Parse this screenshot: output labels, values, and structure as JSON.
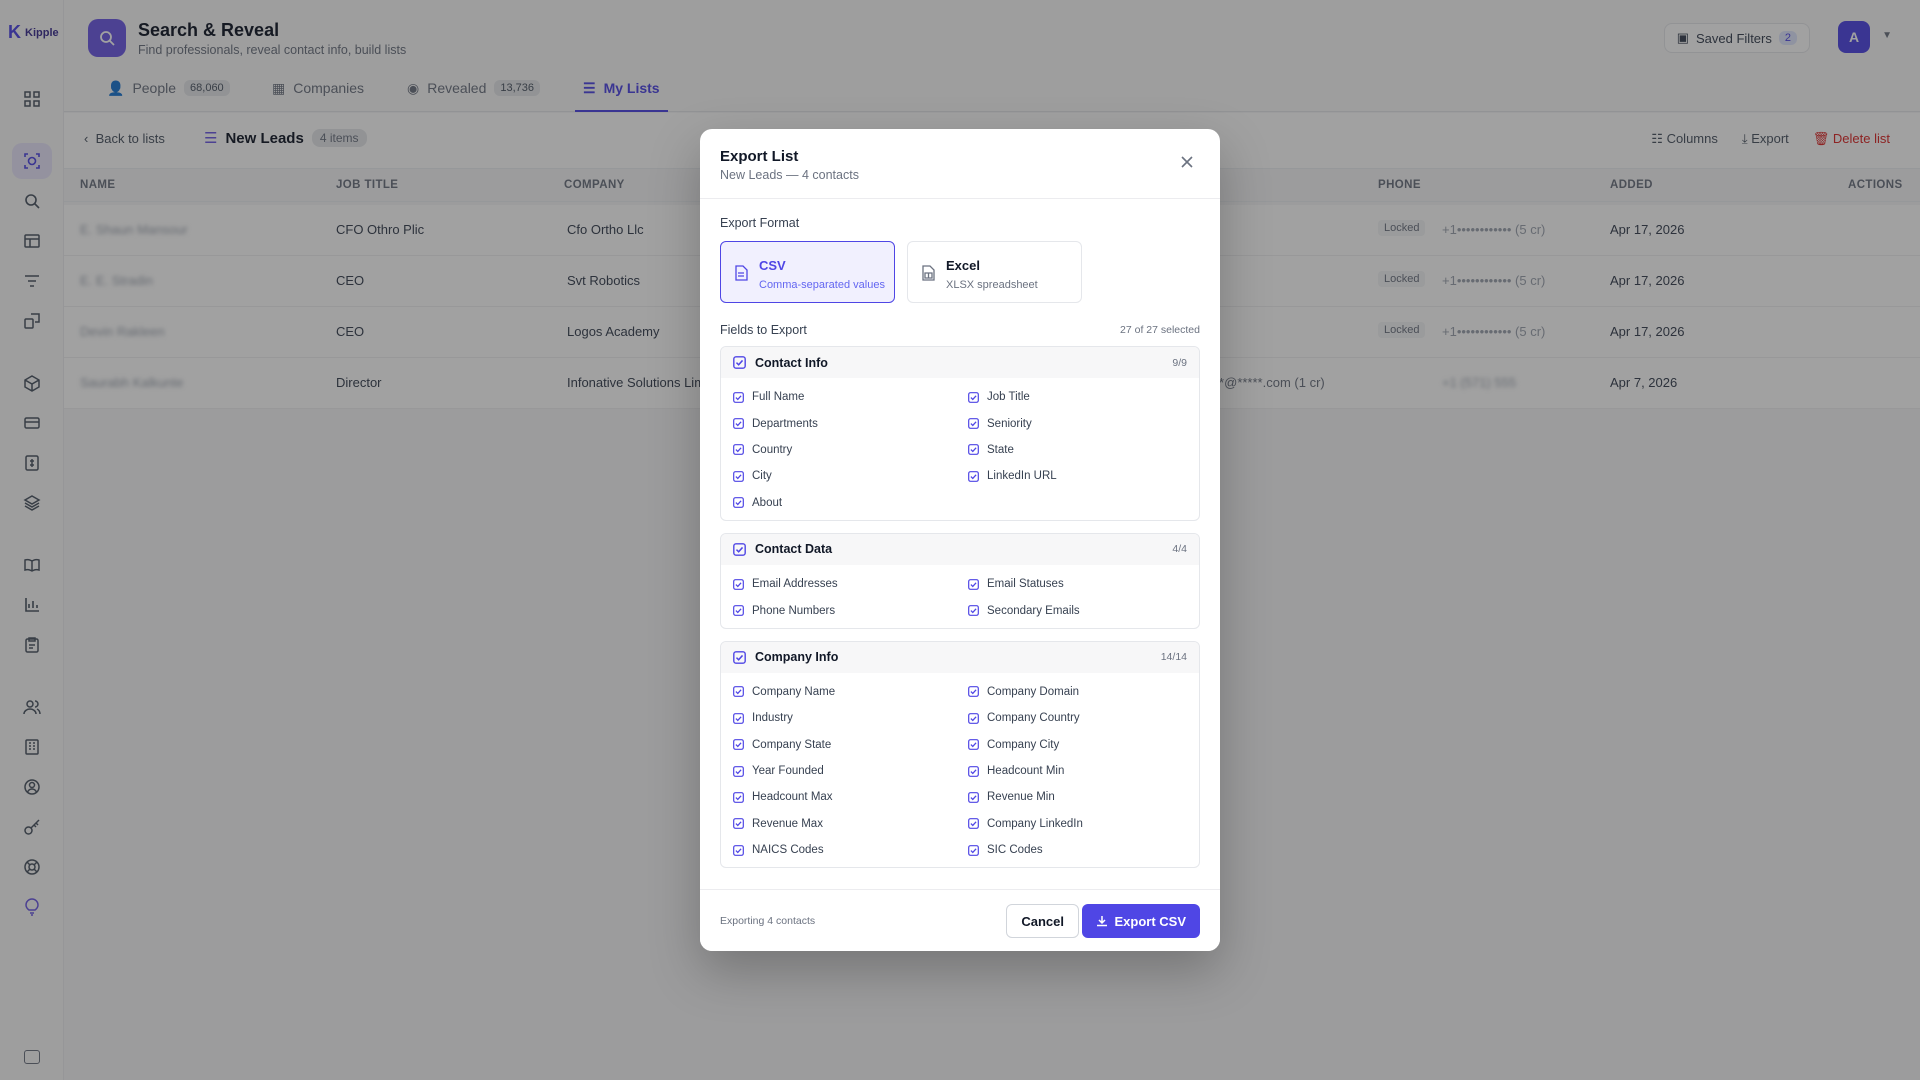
{
  "app": {
    "logo_text": "Kipple",
    "title": "Search & Reveal",
    "subtitle": "Find professionals, reveal contact info, build lists",
    "saved_filters_label": "Saved Filters",
    "saved_filters_count": "2",
    "avatar_initial": "A"
  },
  "tabs": [
    {
      "label": "People",
      "count": "68,060"
    },
    {
      "label": "Companies",
      "count": ""
    },
    {
      "label": "Revealed",
      "count": "13,736"
    },
    {
      "label": "My Lists",
      "count": ""
    }
  ],
  "subbar": {
    "back_label": "Back to lists",
    "list_name": "New Leads",
    "items_badge": "4 items",
    "columns_label": "Columns",
    "export_label": "Export",
    "delete_label": "Delete list"
  },
  "table": {
    "headers": [
      "NAME",
      "JOB TITLE",
      "COMPANY",
      "PHONE",
      "ADDED",
      "ACTIONS"
    ],
    "rows": [
      {
        "name": "E. Shaun Mansour",
        "job_title": "CFO Othro Plic",
        "company": "Cfo Ortho Llc",
        "phone_status": "Locked",
        "phone": "+1•••••••••••• (5 cr)",
        "added": "Apr 17, 2026"
      },
      {
        "name": "E. E. Stradin",
        "job_title": "CEO",
        "company": "Svt Robotics",
        "phone_status": "Locked",
        "phone": "+1•••••••••••• (5 cr)",
        "added": "Apr 17, 2026"
      },
      {
        "name": "Devin Rakleen",
        "job_title": "CEO",
        "company": "Logos Academy",
        "phone_status": "Locked",
        "phone": "+1•••••••••••• (5 cr)",
        "added": "Apr 17, 2026"
      },
      {
        "name": "Saurabh Kalkunte",
        "job_title": "Director",
        "company": "Infonative Solutions Lim",
        "email_fragment": "**@*****.com  (1 cr)",
        "phone": "+1 (571) 555",
        "added": "Apr 7, 2026"
      }
    ]
  },
  "modal": {
    "title": "Export List",
    "subtitle": "New Leads — 4 contacts",
    "format_label": "Export Format",
    "formats": [
      {
        "name": "CSV",
        "desc": "Comma-separated values",
        "selected": true
      },
      {
        "name": "Excel",
        "desc": "XLSX spreadsheet",
        "selected": false
      }
    ],
    "fields_label": "Fields to Export",
    "fields_count": "27 of 27 selected",
    "groups": [
      {
        "title": "Contact Info",
        "count": "9/9",
        "fields": [
          "Full Name",
          "Job Title",
          "Departments",
          "Seniority",
          "Country",
          "State",
          "City",
          "LinkedIn URL",
          "About"
        ]
      },
      {
        "title": "Contact Data",
        "count": "4/4",
        "fields": [
          "Email Addresses",
          "Email Statuses",
          "Phone Numbers",
          "Secondary Emails"
        ]
      },
      {
        "title": "Company Info",
        "count": "14/14",
        "fields": [
          "Company Name",
          "Company Domain",
          "Industry",
          "Company Country",
          "Company State",
          "Company City",
          "Year Founded",
          "Headcount Min",
          "Headcount Max",
          "Revenue Min",
          "Revenue Max",
          "Company LinkedIn",
          "NAICS Codes",
          "SIC Codes"
        ]
      }
    ],
    "footer_info": "Exporting 4 contacts",
    "cancel_label": "Cancel",
    "export_label": "Export CSV"
  },
  "colors": {
    "accent": "#4f46e5",
    "overlay": "rgba(30,30,30,0.42)",
    "danger": "#dc2626"
  }
}
